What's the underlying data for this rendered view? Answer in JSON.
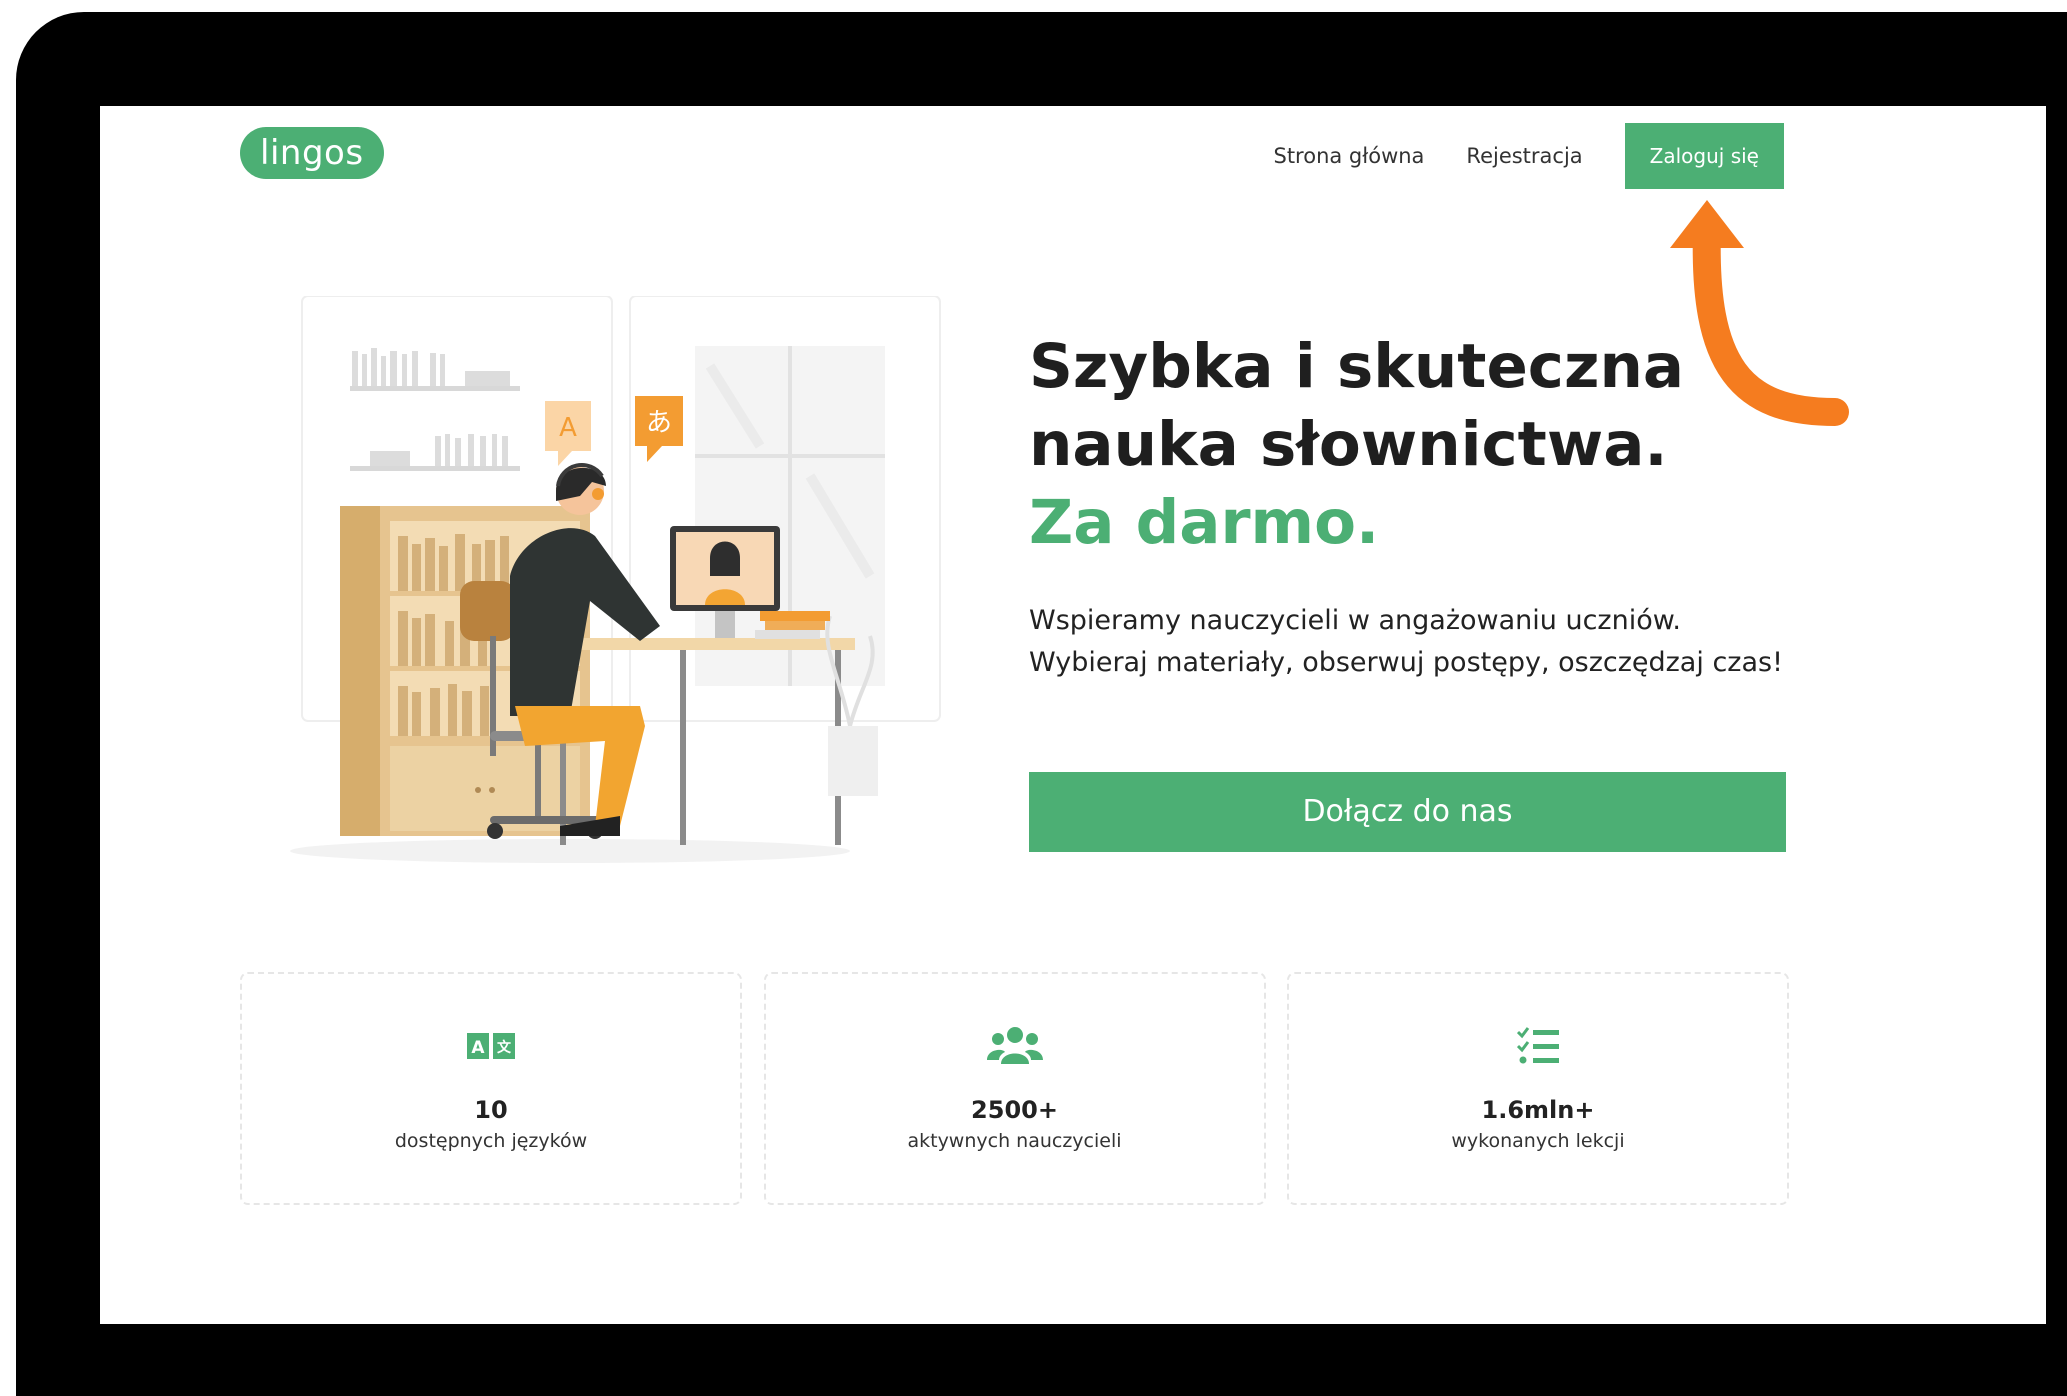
{
  "header": {
    "logo_text": "lingos",
    "nav": {
      "home_label": "Strona główna",
      "register_label": "Rejestracja",
      "login_label": "Zaloguj się"
    }
  },
  "hero": {
    "title_line1": "Szybka i skuteczna",
    "title_line2": "nauka słownictwa.",
    "title_highlight": "Za darmo.",
    "description": "Wspieramy nauczycieli w angażowaniu uczniów. Wybieraj materiały, obserwuj postępy, oszczędzaj czas!",
    "cta_label": "Dołącz do nas",
    "bubble_left": "A",
    "bubble_right": "あ"
  },
  "stats": [
    {
      "icon": "translate-icon",
      "value": "10",
      "label": "dostępnych języków"
    },
    {
      "icon": "users-icon",
      "value": "2500+",
      "label": "aktywnych nauczycieli"
    },
    {
      "icon": "checklist-icon",
      "value": "1.6mln+",
      "label": "wykonanych lekcji"
    }
  ],
  "colors": {
    "accent": "#4caf74",
    "annotation_arrow": "#f57c1f",
    "frame": "#000000"
  }
}
